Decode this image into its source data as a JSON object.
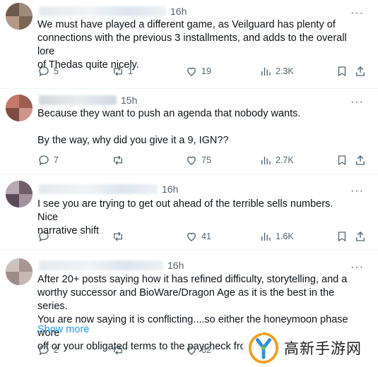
{
  "tweets": [
    {
      "time": "16h",
      "text": "We must have played a different game, as Veilguard has plenty of\nconnections with the previous 3 installments, and adds to the overall lore\nof Thedas quite nicely.",
      "replies": "5",
      "reposts": "1",
      "likes": "19",
      "views": "2.3K",
      "more": "···"
    },
    {
      "time": "15h",
      "text": "Because they want to push an agenda that nobody wants.\n\nBy the way, why did you give it a 9, IGN??",
      "replies": "7",
      "reposts": "",
      "likes": "75",
      "views": "2.7K",
      "more": "···"
    },
    {
      "time": "16h",
      "text": "I see you are trying to get out ahead of the terrible sells numbers. Nice\nnarrative shift",
      "replies": "",
      "reposts": "",
      "likes": "41",
      "views": "1.6K",
      "more": "···"
    },
    {
      "time": "16h",
      "text": "After 20+ posts saying how it has refined difficulty, storytelling, and a\nworthy successor and BioWare/Dragon Age as it is the best in the series.\nYou are now saying it is conflicting....so either the honeymoon phase wore\noff or your obligated terms to the paycheck from EA wore",
      "show_more": "Show more",
      "replies": "2",
      "reposts": "",
      "likes": "62",
      "more": "···"
    }
  ],
  "watermark": {
    "text": "高新手游网"
  },
  "icons": {
    "reply": "reply-icon",
    "repost": "repost-icon",
    "like": "heart-icon",
    "views": "views-icon",
    "bookmark": "bookmark-icon",
    "share": "share-icon"
  },
  "colors": {
    "link": "#1d9bf0",
    "secondary": "#536471",
    "text": "#0f1419"
  }
}
